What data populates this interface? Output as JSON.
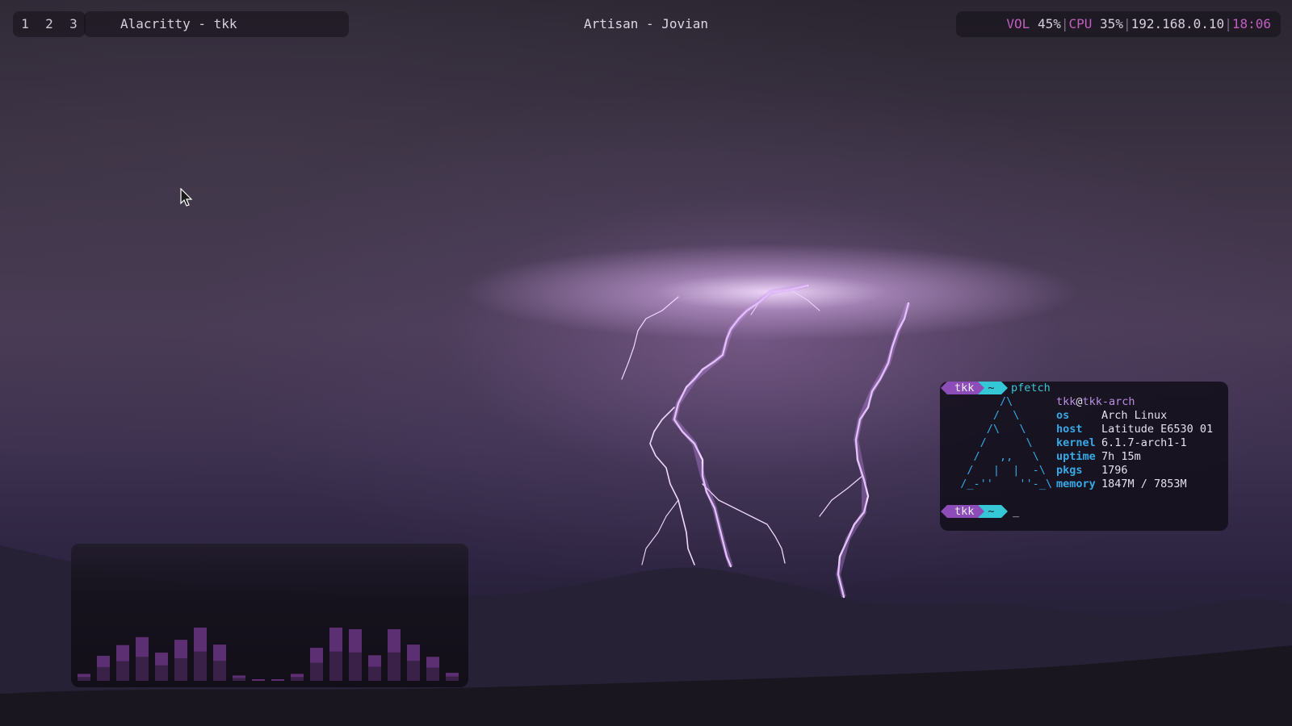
{
  "workspaces": [
    "1",
    "2",
    "3"
  ],
  "window_title": "Alacritty - tkk",
  "center_title": "Artisan - Jovian",
  "status": {
    "vol_label": "VOL",
    "vol_value": "45%",
    "cpu_label": "CPU",
    "cpu_value": "35%",
    "ip": "192.168.0.10",
    "time": "18:06",
    "separator": "|"
  },
  "terminal": {
    "prompt_user": "tkk",
    "prompt_dir": "~",
    "command": "pfetch",
    "caret": "_",
    "logo": "        /\\\n       /  \\\n      /\\   \\\n     /      \\\n    /   ,,   \\\n   /   |  |  -\\\n  /_-''    ''-_\\",
    "fetch": {
      "user": "tkk",
      "at": "@",
      "host": "tkk-arch",
      "rows": [
        {
          "key": "os",
          "value": "Arch Linux"
        },
        {
          "key": "host",
          "value": "Latitude E6530 01"
        },
        {
          "key": "kernel",
          "value": "6.1.7-arch1-1"
        },
        {
          "key": "uptime",
          "value": "7h 15m"
        },
        {
          "key": "pkgs",
          "value": "1796"
        },
        {
          "key": "memory",
          "value": "1847M / 7853M"
        }
      ]
    }
  },
  "visualizer": {
    "levels": [
      0.13,
      0.47,
      0.67,
      0.82,
      0.53,
      0.77,
      1.0,
      0.68,
      0.1,
      0.03,
      0.03,
      0.13,
      0.62,
      1.0,
      0.97,
      0.48,
      0.97,
      0.68,
      0.45,
      0.15
    ],
    "colors": {
      "dark": "#3a2148",
      "light": "#5b2f72"
    }
  },
  "colors": {
    "accent_purple": "#c05fc0",
    "accent_cyan": "#36c7d6",
    "accent_blue": "#36a9e8"
  }
}
